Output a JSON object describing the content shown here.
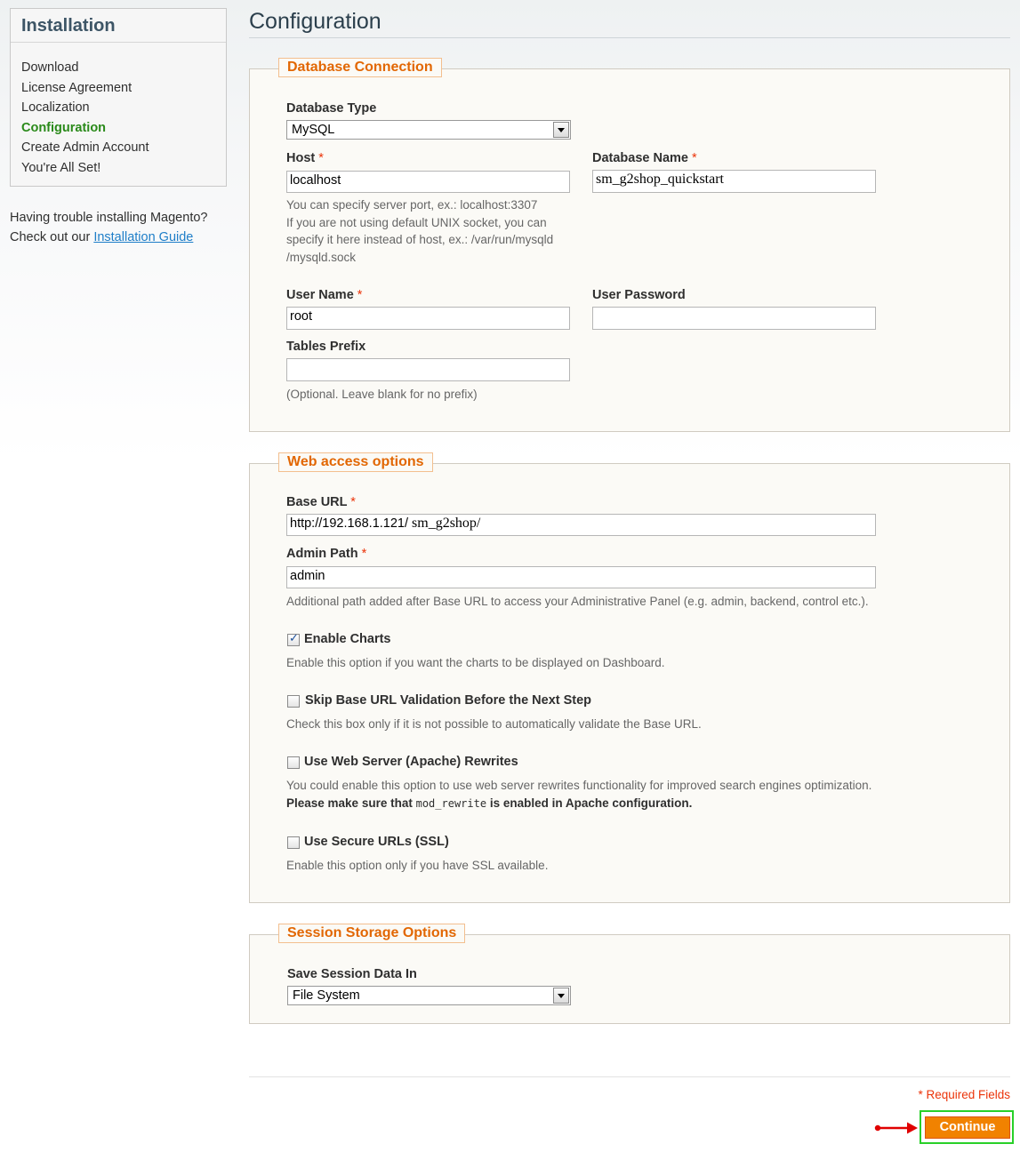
{
  "sidebar": {
    "title": "Installation",
    "steps": [
      {
        "label": "Download",
        "active": false
      },
      {
        "label": "License Agreement",
        "active": false
      },
      {
        "label": "Localization",
        "active": false
      },
      {
        "label": "Configuration",
        "active": true
      },
      {
        "label": "Create Admin Account",
        "active": false
      },
      {
        "label": "You're All Set!",
        "active": false
      }
    ],
    "help_text": "Having trouble installing Magento?",
    "help_prefix": "Check out our",
    "help_link": "Installation Guide"
  },
  "page_title": "Configuration",
  "db": {
    "legend": "Database Connection",
    "type_label": "Database Type",
    "type_value": "MySQL",
    "host_label": "Host",
    "host_value": "localhost",
    "host_note1": "You can specify server port, ex.: localhost:3307",
    "host_note2": "If you are not using default UNIX socket, you can",
    "host_note3": "specify it here instead of host, ex.: /var/run/mysqld",
    "host_note4": "/mysqld.sock",
    "name_label": "Database Name",
    "name_value": "sm_g2shop_quickstart",
    "user_label": "User Name",
    "user_value": "root",
    "password_label": "User Password",
    "password_value": "",
    "prefix_label": "Tables Prefix",
    "prefix_value": "",
    "prefix_note": "(Optional. Leave blank for no prefix)"
  },
  "web": {
    "legend": "Web access options",
    "base_url_label": "Base URL",
    "base_url_value_a": "http://192.168.1.121/",
    "base_url_value_b": " sm_g2shop/",
    "admin_path_label": "Admin Path",
    "admin_path_value": "admin",
    "admin_path_note": "Additional path added after Base URL to access your Administrative Panel (e.g. admin, backend, control etc.).",
    "charts_label": "Enable Charts",
    "charts_checked": true,
    "charts_note": "Enable this option if you want the charts to be displayed on Dashboard.",
    "skip_label": "Skip Base URL Validation Before the Next Step",
    "skip_checked": false,
    "skip_note": "Check this box only if it is not possible to automatically validate the Base URL.",
    "rewrites_label": "Use Web Server (Apache) Rewrites",
    "rewrites_checked": false,
    "rewrites_note": "You could enable this option to use web server rewrites functionality for improved search engines optimization.",
    "rewrites_bold_a": "Please make sure that",
    "rewrites_code": "mod_rewrite",
    "rewrites_bold_b": "is enabled in Apache configuration.",
    "ssl_label": "Use Secure URLs (SSL)",
    "ssl_checked": false,
    "ssl_note": "Enable this option only if you have SSL available."
  },
  "session": {
    "legend": "Session Storage Options",
    "label": "Save Session Data In",
    "value": "File System"
  },
  "footer": {
    "required_fields": "* Required Fields",
    "continue_label": "Continue"
  },
  "required_mark": "*",
  "colors": {
    "accent_orange": "#f18200",
    "legend_orange": "#e26703",
    "active_green": "#2a8a1a",
    "link_blue": "#1e7ec8",
    "required_red": "#eb340a",
    "highlight_green": "#28d028",
    "arrow_red": "#e00000"
  }
}
